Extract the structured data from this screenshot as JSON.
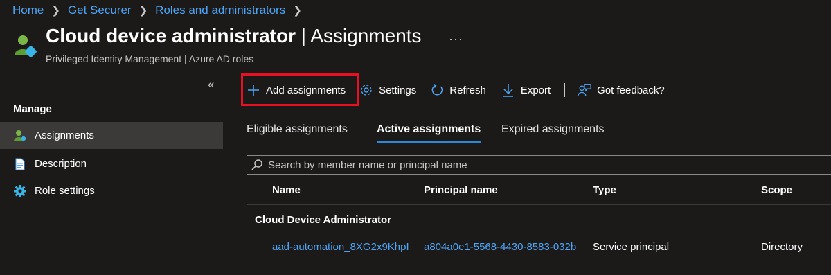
{
  "breadcrumb": {
    "items": [
      "Home",
      "Get Securer",
      "Roles and administrators"
    ]
  },
  "header": {
    "title_bold": "Cloud device administrator",
    "title_separator": " | ",
    "title_section": "Assignments",
    "subtitle": "Privileged Identity Management | Azure AD roles",
    "more": "···",
    "icon": "user-role-icon"
  },
  "sidebar": {
    "collapse": "«",
    "section_label": "Manage",
    "items": [
      {
        "label": "Assignments",
        "icon": "assignments-icon",
        "active": true
      },
      {
        "label": "Description",
        "icon": "document-icon",
        "active": false
      },
      {
        "label": "Role settings",
        "icon": "gear-icon",
        "active": false
      }
    ]
  },
  "toolbar": {
    "add_label": "Add assignments",
    "settings_label": "Settings",
    "refresh_label": "Refresh",
    "export_label": "Export",
    "feedback_label": "Got feedback?"
  },
  "tabs": [
    {
      "label": "Eligible assignments",
      "active": false
    },
    {
      "label": "Active assignments",
      "active": true
    },
    {
      "label": "Expired assignments",
      "active": false
    }
  ],
  "search": {
    "placeholder": "Search by member name or principal name"
  },
  "table": {
    "columns": [
      "Name",
      "Principal name",
      "Type",
      "Scope"
    ],
    "group": "Cloud Device Administrator",
    "rows": [
      {
        "name": "aad-automation_8XG2x9KhpI",
        "principal": "a804a0e1-5568-4430-8583-032b",
        "type": "Service principal",
        "scope": "Directory"
      }
    ]
  },
  "colors": {
    "background": "#1b1a19",
    "link": "#4ea5f5",
    "accent": "#2b88d8",
    "highlight": "#e81123",
    "nav_active": "#3b3a39"
  }
}
